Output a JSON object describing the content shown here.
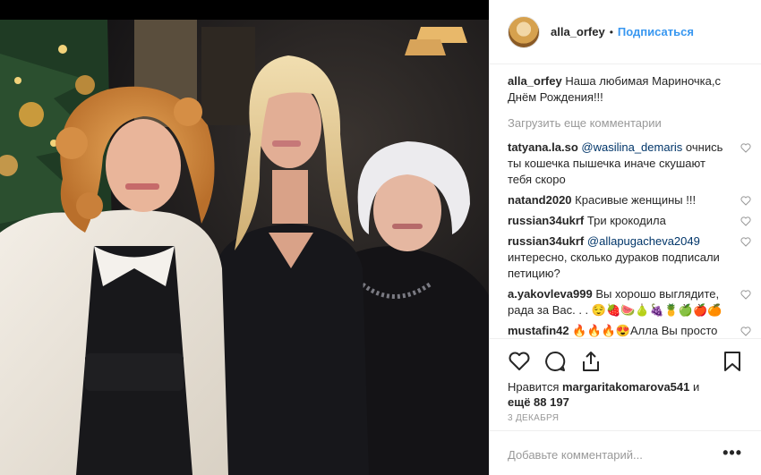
{
  "post": {
    "image_alt": "Three women posing in front of a Christmas tree"
  },
  "header": {
    "username": "alla_orfey",
    "separator": "•",
    "follow_label": "Подписаться"
  },
  "caption": {
    "username": "alla_orfey",
    "text": "Наша любимая Мариночка,с Днём Рождения!!!"
  },
  "load_more_label": "Загрузить еще комментарии",
  "comments": [
    {
      "user": "tatyana.la.so",
      "mention": "@wasilina_demaris",
      "text": "очнись ты кошечка пышечка иначе скушают тебя скоро"
    },
    {
      "user": "natand2020",
      "mention": "",
      "text": "Красивые женщины !!!"
    },
    {
      "user": "russian34ukrf",
      "mention": "",
      "text": "Три крокодила"
    },
    {
      "user": "russian34ukrf",
      "mention": "@allapugacheva2049",
      "text": "интересно, сколько дураков подписали петицию?"
    },
    {
      "user": "a.yakovleva999",
      "mention": "",
      "text": "Вы хорошо выглядите, рада за Вас. . . 😌🍓🍉🍐🍇🍍🍏🍎🍊"
    },
    {
      "user": "mustafin42",
      "mention": "",
      "text": "🔥🔥🔥😍Алла Вы просто космос!"
    }
  ],
  "icons": {
    "like": "heart-outline-icon",
    "comment": "speech-bubble-icon",
    "share": "share-upload-icon",
    "save": "bookmark-icon",
    "more": "more-options-icon"
  },
  "likes": {
    "prefix": "Нравится",
    "user": "margaritakomarova541",
    "suffix": "и",
    "count_text": "ещё 88 197"
  },
  "date": "3 ДЕКАБРЯ",
  "add_comment": {
    "placeholder": "Добавьте комментарий...",
    "more_label": "•••"
  },
  "colors": {
    "link_blue": "#3897f0",
    "mention_blue": "#003569",
    "muted_gray": "#999999",
    "border": "#efefef"
  }
}
